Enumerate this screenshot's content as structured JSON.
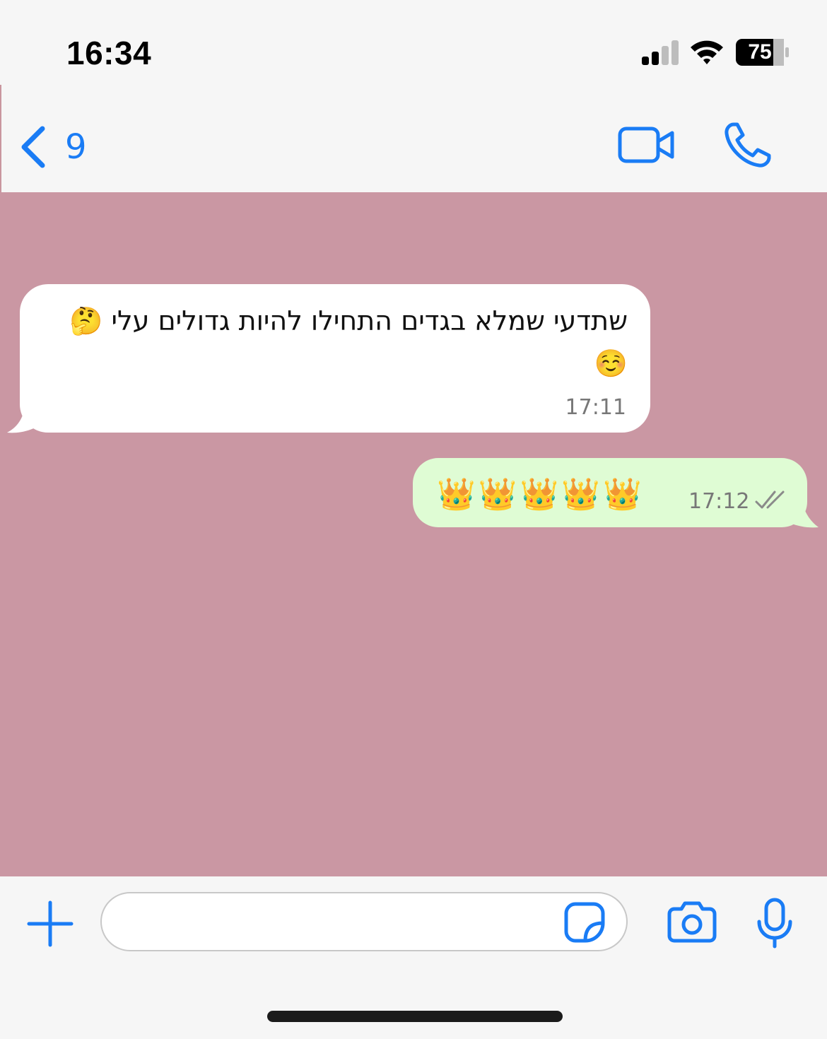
{
  "status_bar": {
    "time": "16:34",
    "battery_level": "75"
  },
  "header": {
    "back_count": "9"
  },
  "messages": [
    {
      "direction": "incoming",
      "text": "שתדעי שמלא בגדים התחילו להיות גדולים עלי 🤔☺️",
      "time": "17:11"
    },
    {
      "direction": "outgoing",
      "text": "👑👑👑👑👑",
      "time": "17:12",
      "status": "read"
    }
  ],
  "colors": {
    "accent": "#1a7cf5",
    "chat_background": "#ca97a3",
    "incoming_bubble": "#ffffff",
    "outgoing_bubble": "#dffcd4"
  },
  "icons": {
    "back": "chevron-left-icon",
    "video_call": "video-camera-icon",
    "voice_call": "phone-icon",
    "attach": "plus-icon",
    "sticker": "sticker-icon",
    "camera": "camera-icon",
    "microphone": "microphone-icon",
    "read_receipt": "double-check-icon"
  }
}
